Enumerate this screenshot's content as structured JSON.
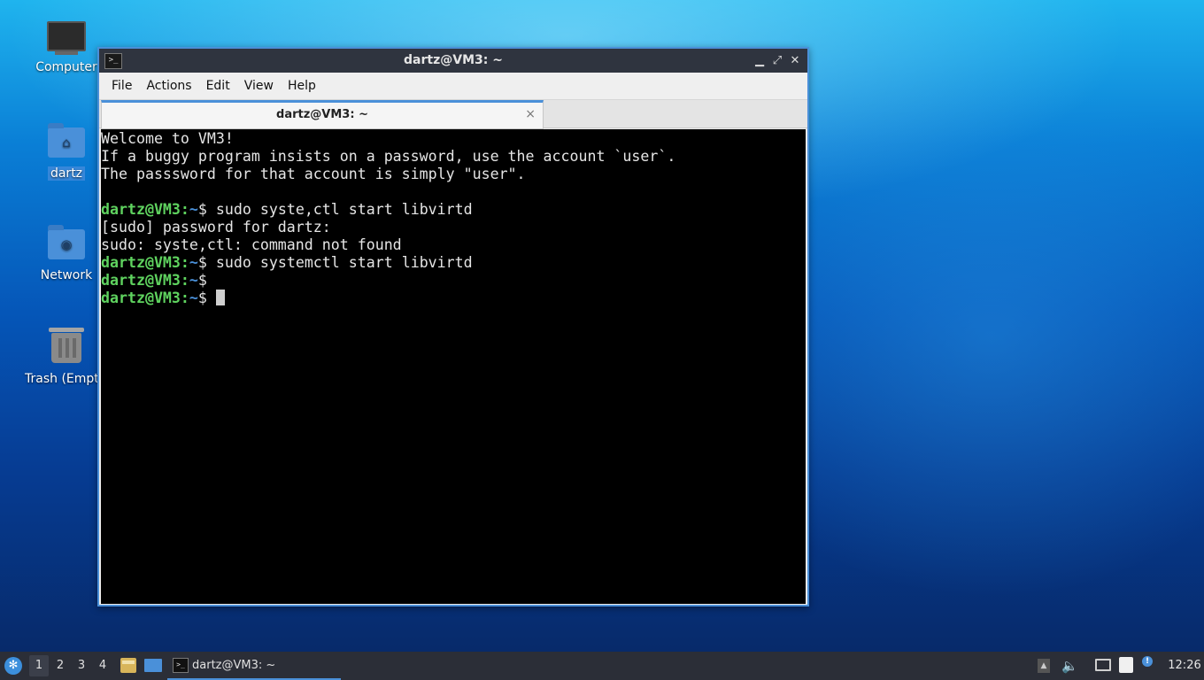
{
  "desktop": {
    "icons": [
      {
        "label": "Computer",
        "icon": "monitor-icon"
      },
      {
        "label": "dartz",
        "icon": "home-folder-icon"
      },
      {
        "label": "Network",
        "icon": "network-folder-icon"
      },
      {
        "label": "Trash (Empt",
        "icon": "trash-icon"
      }
    ]
  },
  "window": {
    "title": "dartz@VM3: ~",
    "menu": [
      "File",
      "Actions",
      "Edit",
      "View",
      "Help"
    ],
    "tab_label": "dartz@VM3: ~",
    "tab_close": "×"
  },
  "terminal": {
    "lines": [
      {
        "type": "text",
        "text": "Welcome to VM3!"
      },
      {
        "type": "text",
        "text": "If a buggy program insists on a password, use the account `user`."
      },
      {
        "type": "text",
        "text": "The passsword for that account is simply \"user\"."
      },
      {
        "type": "text",
        "text": ""
      },
      {
        "type": "prompt",
        "user": "dartz@VM3",
        "path": "~",
        "symbol": "$",
        "cmd": " sudo syste,ctl start libvirtd"
      },
      {
        "type": "text",
        "text": "[sudo] password for dartz:"
      },
      {
        "type": "text",
        "text": "sudo: syste,ctl: command not found"
      },
      {
        "type": "prompt",
        "user": "dartz@VM3",
        "path": "~",
        "symbol": "$",
        "cmd": " sudo systemctl start libvirtd"
      },
      {
        "type": "prompt",
        "user": "dartz@VM3",
        "path": "~",
        "symbol": "$",
        "cmd": ""
      },
      {
        "type": "prompt",
        "user": "dartz@VM3",
        "path": "~",
        "symbol": "$",
        "cmd": " ",
        "cursor": true
      }
    ]
  },
  "taskbar": {
    "workspaces": [
      "1",
      "2",
      "3",
      "4"
    ],
    "active_workspace": "1",
    "task_label": "dartz@VM3: ~",
    "clock": "12:26"
  },
  "colors": {
    "accent": "#4a90d9",
    "prompt_user": "#5fd35f",
    "taskbar_bg": "#2b2e37",
    "titlebar_bg": "#2f343f"
  }
}
